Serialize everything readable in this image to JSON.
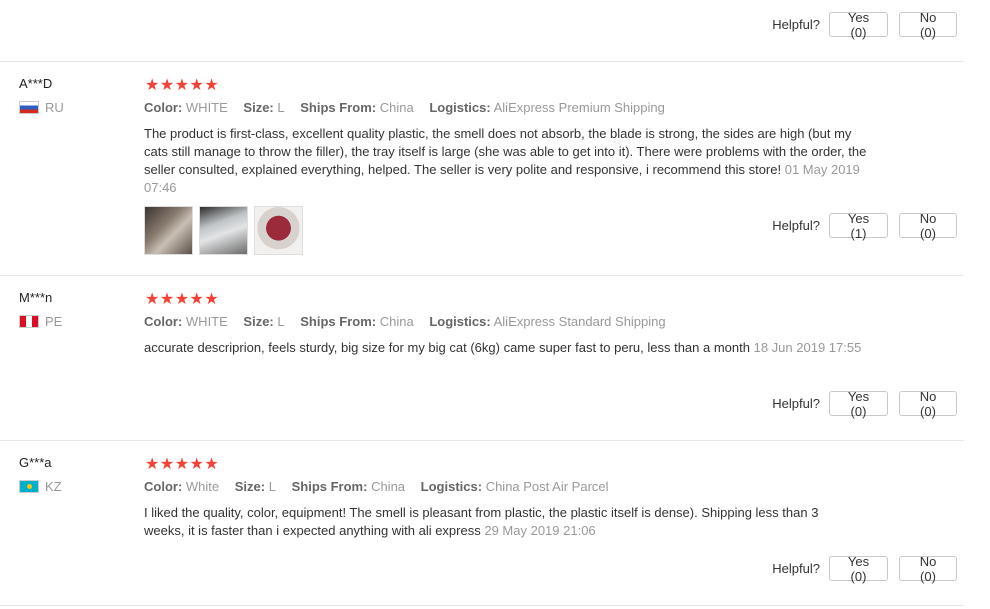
{
  "helpful_label": "Helpful?",
  "top_votes": {
    "yes": "Yes (0)",
    "no": "No (0)"
  },
  "reviews": [
    {
      "user": "A***D",
      "country": "RU",
      "flag": "flag-ru",
      "rating": "★★★★★",
      "color_label": "Color:",
      "color": "WHITE",
      "size_label": "Size:",
      "size": "L",
      "ships_label": "Ships From:",
      "ships": "China",
      "logistics_label": "Logistics:",
      "logistics": "AliExpress Premium Shipping",
      "text": "The product is first-class, excellent quality plastic, the smell does not absorb, the blade is strong, the sides are high (but my cats still manage to throw the filler), the tray itself is large (she was able to get into it). There were problems with the order, the seller consulted, explained everything, helped. The seller is very polite and responsive, i recommend this store!",
      "date": "01 May 2019 07:46",
      "photos": [
        "photo-1",
        "photo-2",
        "photo-3"
      ],
      "yes": "Yes (1)",
      "no": "No (0)"
    },
    {
      "user": "M***n",
      "country": "PE",
      "flag": "flag-pe",
      "rating": "★★★★★",
      "color_label": "Color:",
      "color": "WHITE",
      "size_label": "Size:",
      "size": "L",
      "ships_label": "Ships From:",
      "ships": "China",
      "logistics_label": "Logistics:",
      "logistics": "AliExpress Standard Shipping",
      "text": "accurate descriprion, feels sturdy, big size for my big cat (6kg) came super fast to peru, less than a month",
      "date": "18 Jun 2019 17:55",
      "yes": "Yes (0)",
      "no": "No (0)"
    },
    {
      "user": "G***a",
      "country": "KZ",
      "flag": "flag-kz",
      "rating": "★★★★★",
      "color_label": "Color:",
      "color": "White",
      "size_label": "Size:",
      "size": "L",
      "ships_label": "Ships From:",
      "ships": "China",
      "logistics_label": "Logistics:",
      "logistics": "China Post Air Parcel",
      "text": "I liked the quality, color, equipment! The smell is pleasant from plastic, the plastic itself is dense). Shipping less than 3 weeks, it is faster than i expected anything with ali express",
      "date": "29 May 2019 21:06",
      "yes": "Yes (0)",
      "no": "No (0)"
    }
  ],
  "colors": {
    "star": "#f44336",
    "muted": "#999999",
    "border": "#c8c8c8"
  }
}
